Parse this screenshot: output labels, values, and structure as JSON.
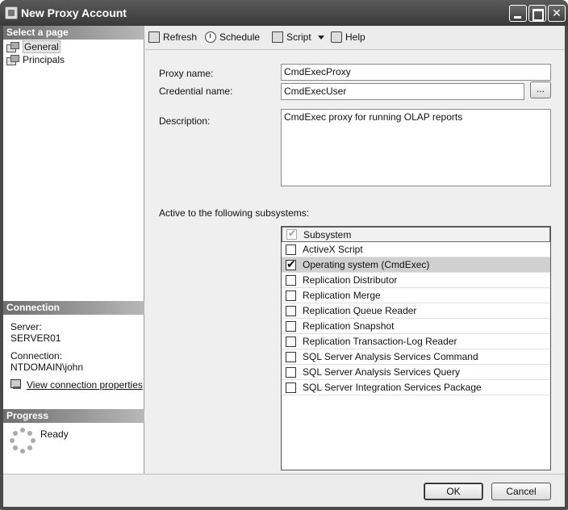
{
  "window": {
    "title": "New Proxy Account"
  },
  "left": {
    "select_page_header": "Select a page",
    "pages": [
      {
        "label": "General",
        "selected": true
      },
      {
        "label": "Principals",
        "selected": false
      }
    ],
    "connection_header": "Connection",
    "server_label": "Server:",
    "server_value": "SERVER01",
    "connection_label": "Connection:",
    "connection_value": "NTDOMAIN\\john",
    "view_connection_link": "View connection properties",
    "progress_header": "Progress",
    "progress_status": "Ready"
  },
  "toolbar": {
    "refresh": "Refresh",
    "schedule": "Schedule",
    "script": "Script",
    "help": "Help"
  },
  "form": {
    "proxy_name_label": "Proxy name:",
    "proxy_name_value": "CmdExecProxy",
    "credential_name_label": "Credential name:",
    "credential_name_value": "CmdExecUser",
    "credential_browse": "...",
    "description_label": "Description:",
    "description_value": "CmdExec proxy for running OLAP reports",
    "subsystems_label": "Active to the following subsystems:"
  },
  "subsystems": {
    "header": "Subsystem",
    "items": [
      {
        "label": "ActiveX Script",
        "checked": false
      },
      {
        "label": "Operating system (CmdExec)",
        "checked": true
      },
      {
        "label": "Replication Distributor",
        "checked": false
      },
      {
        "label": "Replication Merge",
        "checked": false
      },
      {
        "label": "Replication Queue Reader",
        "checked": false
      },
      {
        "label": "Replication Snapshot",
        "checked": false
      },
      {
        "label": "Replication Transaction-Log Reader",
        "checked": false
      },
      {
        "label": "SQL Server Analysis Services Command",
        "checked": false
      },
      {
        "label": "SQL Server Analysis Services Query",
        "checked": false
      },
      {
        "label": "SQL Server Integration Services Package",
        "checked": false
      }
    ]
  },
  "buttons": {
    "ok": "OK",
    "cancel": "Cancel"
  }
}
